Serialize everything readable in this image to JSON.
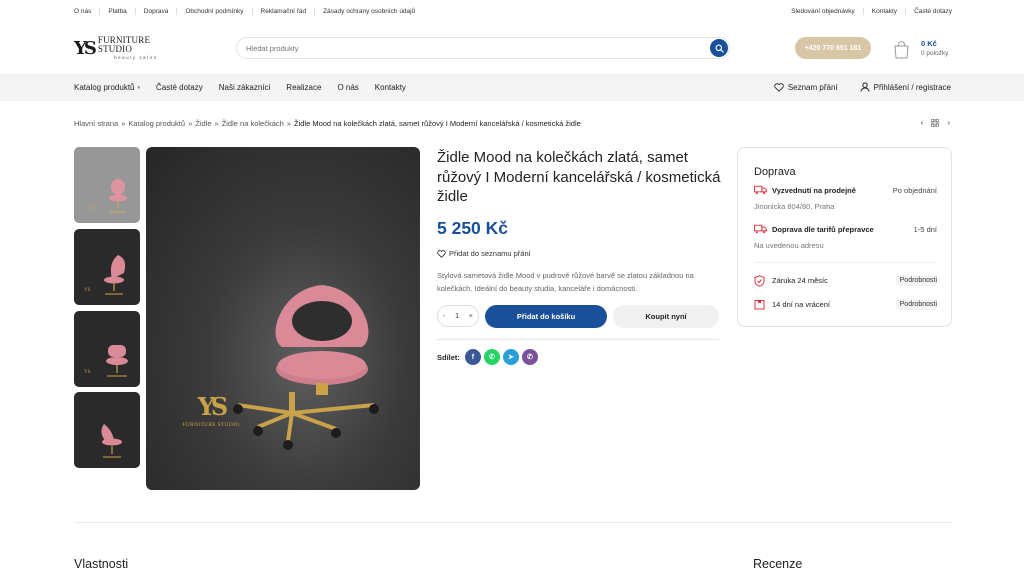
{
  "topbar": {
    "left": [
      "O nás",
      "Platba",
      "Doprava",
      "Obchodní podmínky",
      "Reklamační řád",
      "Zásady ochrany osobních údajů"
    ],
    "right": [
      "Sledování objednávky",
      "Kontakty",
      "Časté dotazy"
    ]
  },
  "header": {
    "logo_mark": "YS",
    "logo_name": "FURNITURE STUDIO",
    "logo_tagline": "beauty salon",
    "search_placeholder": "Hledat produkty",
    "phone": "+420 770 651 181",
    "cart_price": "0 Kč",
    "cart_items": "0 položky"
  },
  "nav": {
    "items": [
      "Katalog produktů",
      "Časté dotazy",
      "Naši zákazníci",
      "Realizace",
      "O nás",
      "Kontakty"
    ],
    "wishlist": "Seznam přání",
    "login": "Přihlášení / registrace"
  },
  "breadcrumb": [
    "Hlavní strana",
    "Katalog produktů",
    "Židle",
    "Židle na kolečkách",
    "Židle Mood na kolečkách zlatá, samet růžový I Moderní kancelářská / kosmetická židle"
  ],
  "breadcrumb_sep": "»",
  "product": {
    "title": "Židle Mood na kolečkách zlatá, samet růžový I Moderní kancelářská / kosmetická židle",
    "price": "5 250 Kč",
    "wishlist_label": "Přidat do seznamu přání",
    "description": "Stylová sametová židle Mood v pudrově růžové barvě se zlatou základnou na kolečkách. Ideální do beauty studia, kanceláře i domácnosti.",
    "qty": "1",
    "qty_minus": "-",
    "qty_plus": "+",
    "add_to_cart": "Přidat do košíku",
    "buy_now": "Koupit nyní",
    "share_label": "Sdílet:",
    "image_brand": "YS",
    "image_brand_name": "FURNITURE STUDIO"
  },
  "delivery": {
    "heading": "Doprava",
    "pickup_label": "Vyzvednutí na prodejně",
    "pickup_value": "Po objednání",
    "pickup_address": "Jinonicka 804/80, Praha",
    "carrier_label": "Doprava dle tarifů přepravce",
    "carrier_value": "1-5 dní",
    "carrier_sub": "Na uvedenou adresu",
    "warranty_label": "Záruka 24 měsíc",
    "return_label": "14 dní na vrácení",
    "details": "Podrobnosti"
  },
  "sections": {
    "properties": "Vlastnosti",
    "reviews": "Recenze"
  },
  "colors": {
    "primary": "#1a4f99",
    "accent_gold": "#d8c6a6",
    "chair_pink": "#d98a96",
    "gold_base": "#c9a24a",
    "facebook": "#3b5998",
    "whatsapp": "#25d366",
    "telegram": "#2aa0da",
    "viber": "#7b519d",
    "delivery_red": "#d9333f"
  }
}
